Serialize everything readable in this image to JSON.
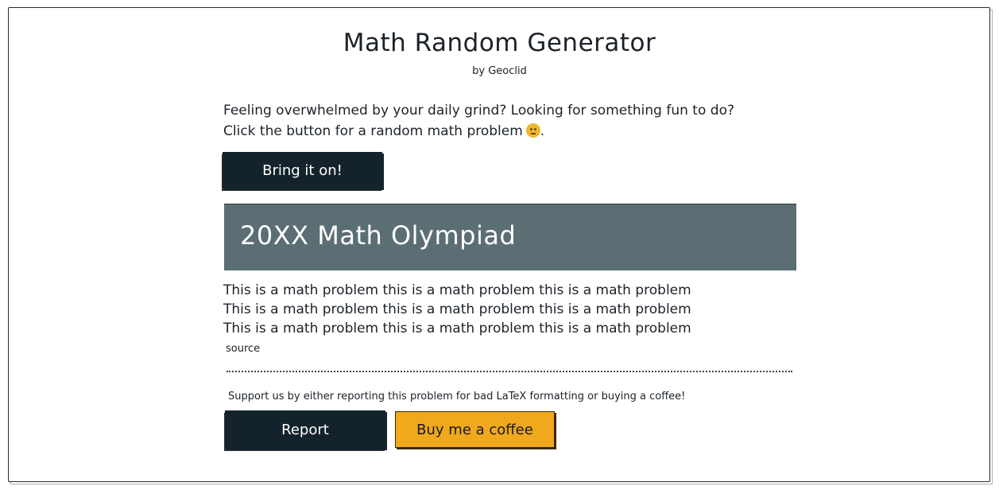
{
  "header": {
    "title": "Math Random Generator",
    "subtitle": "by Geoclid"
  },
  "intro": {
    "line1": "Feeling overwhelmed by your daily grind? Looking for something fun to do?",
    "line2": "Click the button for a random math problem",
    "line2_suffix": ".",
    "emoji_icon": "smiling-face-icon"
  },
  "actions": {
    "generate_label": "Bring it on!"
  },
  "problem_card": {
    "banner_title": "20XX Math Olympiad",
    "banner_color": "#5b6e74",
    "lines": [
      "This is a math problem this is a math problem this is a math problem",
      "This is a math problem this is a math problem this is a math problem",
      "This is a math problem this is a math problem this is a math problem"
    ],
    "source_link": "source"
  },
  "footer": {
    "support_text": "Support us by either reporting this problem for bad LaTeX formatting or buying a coffee!",
    "report_label": "Report",
    "coffee_label": "Buy me a coffee",
    "coffee_color": "#f0a81d",
    "dark_button_color": "#14232b"
  }
}
